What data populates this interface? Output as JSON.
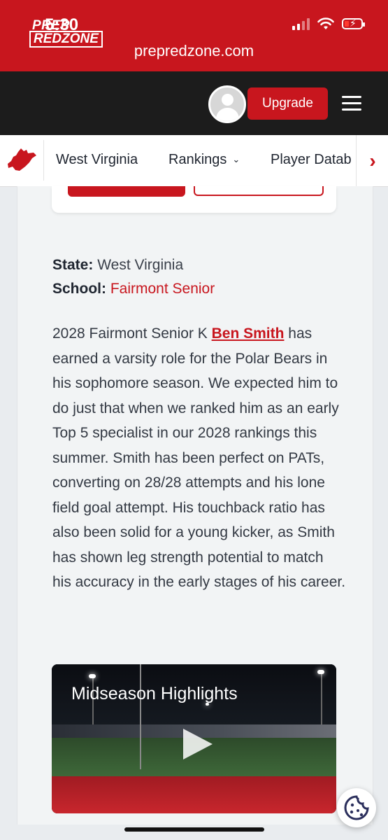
{
  "status_bar": {
    "time": "5:30",
    "url": "prepredzone.com"
  },
  "header": {
    "logo_top": "PREP",
    "logo_bottom": "REDZONE",
    "upgrade_label": "Upgrade"
  },
  "nav": {
    "items": [
      {
        "label": "West Virginia"
      },
      {
        "label": "Rankings",
        "chevron": "⌄"
      },
      {
        "label": "Player Datab"
      }
    ],
    "next_arrow": "›"
  },
  "profile": {
    "state_label": "State:",
    "state_value": "West Virginia",
    "school_label": "School:",
    "school_value": "Fairmont Senior"
  },
  "article": {
    "before_link": "2028 Fairmont Senior K ",
    "link_text": "Ben Smith",
    "after_link": " has earned a varsity role for the Polar Bears in his sophomore season. We expected him to do just that when we ranked him as an early Top 5 specialist in our 2028 rankings this summer. Smith has been perfect on PATs, converting on 28/28 attempts and his lone field goal attempt. His touchback ratio has also been solid for a young kicker, as Smith has shown leg strength potential to match his accuracy in the early stages of his career."
  },
  "video": {
    "title": "Midseason Highlights"
  },
  "colors": {
    "brand_red": "#c8161e",
    "header_dark": "#1c1c1c"
  }
}
